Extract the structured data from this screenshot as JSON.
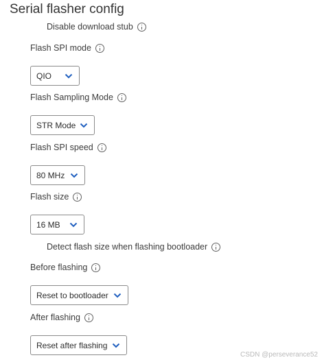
{
  "section": {
    "title": "Serial flasher config"
  },
  "fields": {
    "disable_download_stub": {
      "label": "Disable download stub"
    },
    "flash_spi_mode": {
      "label": "Flash SPI mode",
      "value": "QIO"
    },
    "flash_sampling_mode": {
      "label": "Flash Sampling Mode",
      "value": "STR Mode"
    },
    "flash_spi_speed": {
      "label": "Flash SPI speed",
      "value": "80 MHz"
    },
    "flash_size": {
      "label": "Flash size",
      "value": "16 MB"
    },
    "detect_flash_size": {
      "label": "Detect flash size when flashing bootloader"
    },
    "before_flashing": {
      "label": "Before flashing",
      "value": "Reset to bootloader"
    },
    "after_flashing": {
      "label": "After flashing",
      "value": "Reset after flashing"
    }
  },
  "watermark": "CSDN @perseverance52",
  "colors": {
    "chevron": "#1f5fbf",
    "border": "#8a8a8a",
    "text": "#3b3b3b"
  },
  "icons": {
    "info": "info-icon",
    "dropdown": "chevron-down-icon"
  }
}
